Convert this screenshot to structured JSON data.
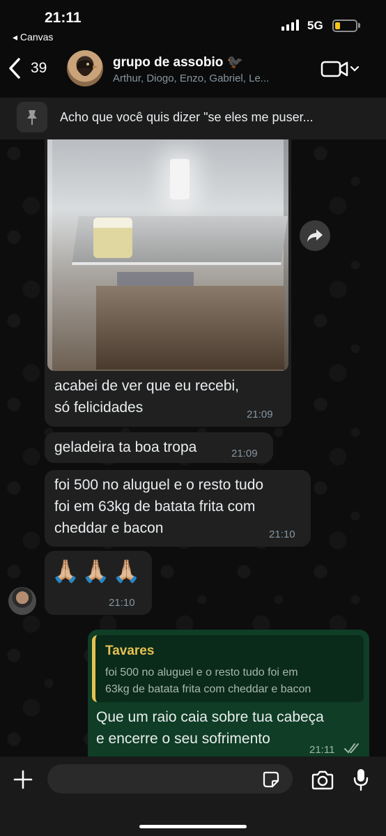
{
  "status_bar": {
    "time": "21:11",
    "back_app": "◂ Canvas",
    "network": "5G",
    "battery_level": 0.25
  },
  "header": {
    "unread_count": "39",
    "group_name": "grupo de assobio 🐦‍⬛",
    "members": "Arthur, Diogo, Enzo, Gabriel, Le..."
  },
  "pinned": {
    "text": "Acho que você quis dizer \"se eles me puser..."
  },
  "messages": [
    {
      "type": "image",
      "caption_lines": [
        "acabei de ver que eu recebi,",
        "só felicidades"
      ],
      "time": "21:09"
    },
    {
      "type": "text",
      "text": "geladeira ta boa tropa",
      "time": "21:09"
    },
    {
      "type": "text",
      "lines": [
        "foi 500 no aluguel e o resto tudo",
        "foi em 63kg de batata frita com",
        "cheddar e bacon"
      ],
      "time": "21:10"
    },
    {
      "type": "emoji",
      "text": "🙏🏼🙏🏼🙏🏼",
      "time": "21:10"
    },
    {
      "type": "outgoing",
      "quote_author": "Tavares",
      "quote_lines": [
        "foi 500 no aluguel e o resto tudo foi em",
        "63kg de batata frita com cheddar e bacon"
      ],
      "lines": [
        "Que um raio caia sobre tua cabeça",
        "e encerre o seu sofrimento"
      ],
      "time": "21:11"
    }
  ],
  "colors": {
    "accent": "#e6c150",
    "outgoing_bubble": "#0f3d25",
    "incoming_bubble": "#202020"
  }
}
